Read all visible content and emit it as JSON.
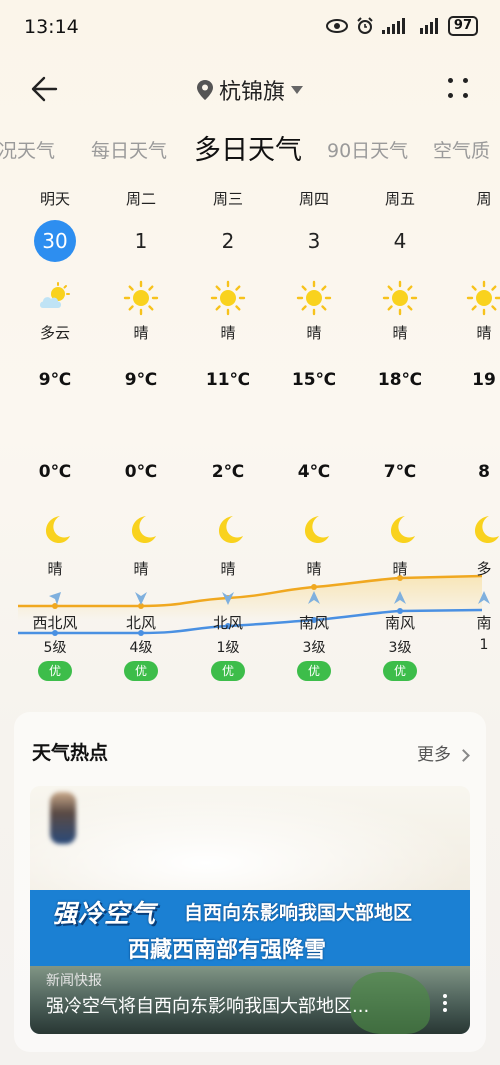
{
  "status": {
    "time": "13:14",
    "battery": "97"
  },
  "nav": {
    "location": "杭锦旗"
  },
  "tabs": [
    "况天气",
    "每日天气",
    "多日天气",
    "90日天气",
    "空气质"
  ],
  "days": [
    {
      "dow": "明天",
      "date": "30",
      "today": true,
      "day_icon": "partly-cloudy-icon",
      "day_cond": "多云",
      "hi": "9℃",
      "lo": "0℃",
      "night_cond": "晴",
      "wind_dir": "西北风",
      "wind_lvl": "5级",
      "aqi": "优"
    },
    {
      "dow": "周二",
      "date": "1",
      "day_icon": "sun-icon",
      "day_cond": "晴",
      "hi": "9℃",
      "lo": "0℃",
      "night_cond": "晴",
      "wind_dir": "北风",
      "wind_lvl": "4级",
      "aqi": "优"
    },
    {
      "dow": "周三",
      "date": "2",
      "day_icon": "sun-icon",
      "day_cond": "晴",
      "hi": "11℃",
      "lo": "2℃",
      "night_cond": "晴",
      "wind_dir": "北风",
      "wind_lvl": "1级",
      "aqi": "优"
    },
    {
      "dow": "周四",
      "date": "3",
      "day_icon": "sun-icon",
      "day_cond": "晴",
      "hi": "15℃",
      "lo": "4℃",
      "night_cond": "晴",
      "wind_dir": "南风",
      "wind_lvl": "3级",
      "aqi": "优"
    },
    {
      "dow": "周五",
      "date": "4",
      "day_icon": "sun-icon",
      "day_cond": "晴",
      "hi": "18℃",
      "lo": "7℃",
      "night_cond": "晴",
      "wind_dir": "南风",
      "wind_lvl": "3级",
      "aqi": "优"
    },
    {
      "dow": "周",
      "date": "",
      "day_icon": "sun-icon",
      "day_cond": "晴",
      "hi": "19",
      "lo": "8",
      "night_cond": "多",
      "wind_dir": "南",
      "wind_lvl": "1",
      "aqi": ""
    }
  ],
  "hot": {
    "title": "天气热点",
    "more": "更多",
    "news": {
      "banner_title": "强冷空气",
      "banner_line1": "自西向东影响我国大部地区",
      "banner_line2": "西藏西南部有强降雪",
      "tag": "新闻快报",
      "caption": "强冷空气将自西向东影响我国大部地区..."
    }
  },
  "colors": {
    "hi_line": "#f0a820",
    "lo_line": "#4a90e2",
    "today_badge": "#2d8ef0",
    "aqi_good": "#3dbd4a"
  }
}
